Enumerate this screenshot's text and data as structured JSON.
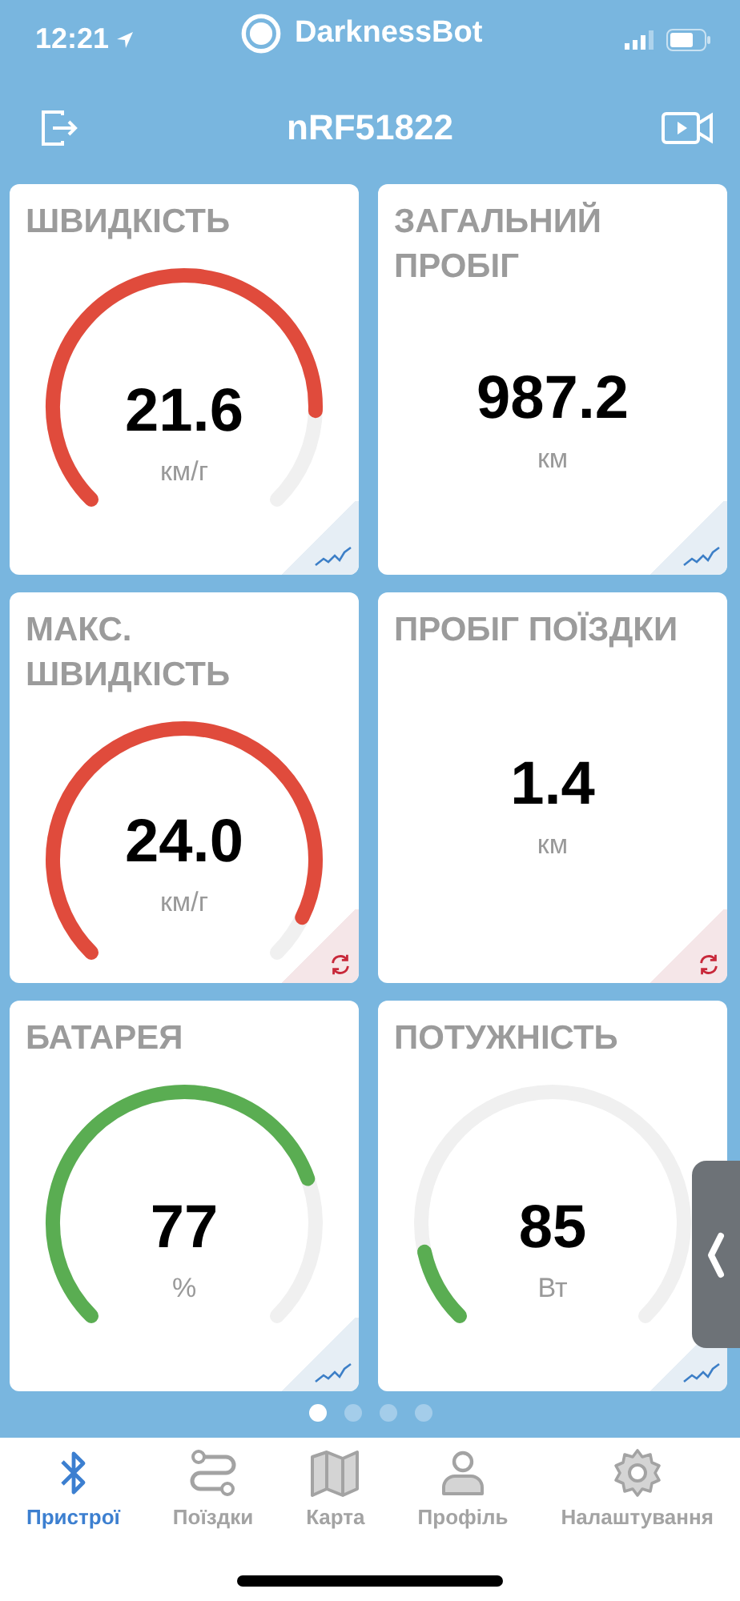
{
  "status_bar": {
    "time": "12:21",
    "app_name": "DarknessBot"
  },
  "header": {
    "title": "nRF51822"
  },
  "cards": [
    {
      "title": "ШВИДКІСТЬ",
      "value": "21.6",
      "unit": "км/г",
      "kind": "gauge",
      "color": "#e04b3c",
      "corner": {
        "kind": "chart"
      }
    },
    {
      "title": "ЗАГАЛЬНИЙ ПРОБІГ",
      "value": "987.2",
      "unit": "км",
      "kind": "plain",
      "corner": {
        "kind": "chart"
      }
    },
    {
      "title": "МАКС. ШВИДКІСТЬ",
      "value": "24.0",
      "unit": "км/г",
      "kind": "gauge",
      "color": "#e04b3c",
      "corner": {
        "kind": "reset"
      }
    },
    {
      "title": "ПРОБІГ ПОЇЗДКИ",
      "value": "1.4",
      "unit": "км",
      "kind": "plain",
      "corner": {
        "kind": "reset"
      }
    },
    {
      "title": "БАТАРЕЯ",
      "value": "77",
      "unit": "%",
      "kind": "gauge",
      "color": "#5aad52",
      "corner": {
        "kind": "chart"
      }
    },
    {
      "title": "ПОТУЖНІСТЬ",
      "value": "85",
      "unit": "Вт",
      "kind": "gauge",
      "color": "#5aad52",
      "corner": {
        "kind": "chart"
      }
    }
  ],
  "page_dots": [
    {
      "selected": true
    },
    {
      "selected": false
    },
    {
      "selected": false
    },
    {
      "selected": false
    }
  ],
  "tabs": [
    {
      "label": "Пристрої",
      "kind": "bluetooth",
      "selected": true
    },
    {
      "label": "Поїздки",
      "kind": "route",
      "selected": false
    },
    {
      "label": "Карта",
      "kind": "map",
      "selected": false
    },
    {
      "label": "Профіль",
      "kind": "person",
      "selected": false
    },
    {
      "label": "Налаштування",
      "kind": "gear",
      "selected": false
    }
  ]
}
